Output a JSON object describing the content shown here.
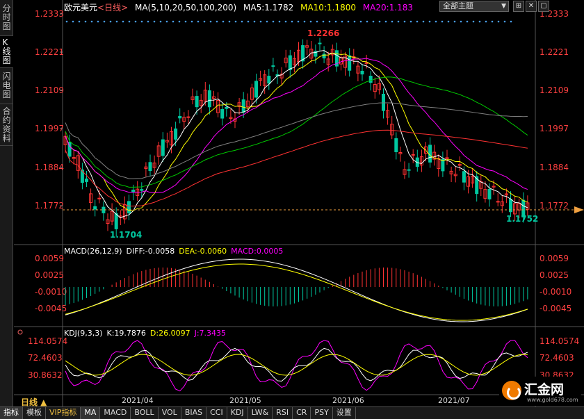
{
  "sidebar": {
    "tabs": [
      {
        "label": "分时图",
        "active": false
      },
      {
        "label": "K线图",
        "active": true
      },
      {
        "label": "闪电图",
        "active": false
      },
      {
        "label": "合约资料",
        "active": false
      }
    ]
  },
  "header": {
    "symbol": "欧元美元",
    "period_tag": "<日线>",
    "ma_params": "MA(5,10,20,50,100,200)",
    "ma5": "MA5:1.1782",
    "ma10": "MA10:1.1800",
    "ma20": "MA20:1.183",
    "dropdown": "全部主题",
    "win_buttons": [
      "⊞",
      "✕",
      "▢"
    ]
  },
  "price_axis": [
    "1.2333",
    "1.2221",
    "1.2109",
    "1.1997",
    "1.1884",
    "1.1772"
  ],
  "annotations": {
    "high": "1.2266",
    "low": "1.1704",
    "last": "1.1752"
  },
  "macd": {
    "label": "MACD(26,12,9)",
    "diff": "DIFF:-0.0058",
    "dea": "DEA:-0.0060",
    "macd": "MACD:0.0005",
    "axis": [
      "0.0059",
      "0.0025",
      "-0.0010",
      "-0.0045"
    ]
  },
  "kdj": {
    "label": "KDJ(9,3,3)",
    "k": "K:19.7876",
    "d": "D:26.0097",
    "j": "J:7.3435",
    "axis": [
      "114.0574",
      "72.4603",
      "30.8632"
    ]
  },
  "x_axis": [
    "2021/04",
    "2021/05",
    "2021/06",
    "2021/07"
  ],
  "period_label": "日线 ▲",
  "bottom_tabs": [
    {
      "label": "指标",
      "active": true
    },
    {
      "label": "模板"
    },
    {
      "label": "VIP指标",
      "vip": true
    },
    {
      "label": "MA",
      "active": true
    },
    {
      "label": "MACD"
    },
    {
      "label": "BOLL"
    },
    {
      "label": "VOL"
    },
    {
      "label": "BIAS"
    },
    {
      "label": "CCI"
    },
    {
      "label": "KDJ"
    },
    {
      "label": "LW&"
    },
    {
      "label": "RSI"
    },
    {
      "label": "CR"
    },
    {
      "label": "PSY"
    },
    {
      "label": "设置"
    }
  ],
  "logo": {
    "name": "汇金网",
    "url": "www.gold678.com"
  },
  "colors": {
    "up": "#ff3232",
    "down": "#00c8a0",
    "ma5": "#ffffff",
    "ma10": "#ffff00",
    "ma20": "#ff00ff",
    "ma50": "#00c800",
    "ma100": "#808080",
    "ma200": "#ff3232",
    "axis_text": "#ff4040"
  }
}
